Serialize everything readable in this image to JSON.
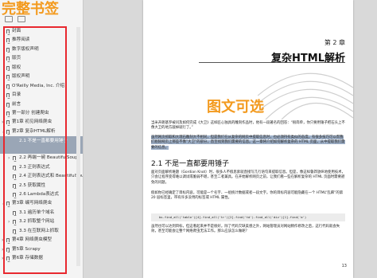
{
  "sidebar": {
    "banner": "完整书签",
    "items": [
      {
        "label": "封面",
        "chev": ""
      },
      {
        "label": "推荐阅读",
        "chev": ""
      },
      {
        "label": "数字版权声明",
        "chev": ""
      },
      {
        "label": "版页",
        "chev": ""
      },
      {
        "label": "版权",
        "chev": ""
      },
      {
        "label": "版权声明",
        "chev": ""
      },
      {
        "label": "O'Reilly Media, Inc. 介绍",
        "chev": ""
      },
      {
        "label": "目录",
        "chev": ""
      },
      {
        "label": "前言",
        "chev": ""
      },
      {
        "label": "第一部分 创建爬虫",
        "chev": ""
      },
      {
        "label": "第1章 初见网络爬虫",
        "chev": "›"
      },
      {
        "label": "第2章 复杂HTML解析",
        "chev": "⌄"
      },
      {
        "label": "2.1 不是一直都要用锤子",
        "chev": "",
        "selected": true
      },
      {
        "label": "2.2 再端一碗 BeautifulSoup",
        "chev": "›"
      },
      {
        "label": "2.3 正则表达式",
        "chev": ""
      },
      {
        "label": "2.4 正则表达式和 BeautifulSoup",
        "chev": ""
      },
      {
        "label": "2.5 获取属性",
        "chev": ""
      },
      {
        "label": "2.6 Lambda表达式",
        "chev": ""
      },
      {
        "label": "第3章 编写网络爬虫",
        "chev": "⌄"
      },
      {
        "label": "3.1 遍历单个域名",
        "chev": ""
      },
      {
        "label": "3.2 抓取整个网站",
        "chev": "›"
      },
      {
        "label": "3.3 在互联网上抓取",
        "chev": ""
      },
      {
        "label": "第4章 网络爬虫模型",
        "chev": "›"
      },
      {
        "label": "第5章 Scrapy",
        "chev": "›"
      },
      {
        "label": "第6章 存储数据",
        "chev": "›"
      }
    ]
  },
  "page": {
    "chapter_label": "第 2 章",
    "chapter_title": "复杂HTML解析",
    "overlay": "图文可选",
    "para1": "当米开朗基罗被问及如何完成《大卫》这样匠心独具的雕刻作品时，他有一段著名的回答：“很简单，你只要用锤子把石头上不像大卫的地方敲掉就行了。”",
    "para2_hl": "虽然网页抓取和大理石雕刻大不相同，但是我们在从复杂的网页中提取信息时，也必须持有类似的态度。有很多技巧可以帮我们剔除网页上那些不像“大卫”的部分，直至找到我们需要的信息。这一章将介绍如何解析复杂的 HTML 页面，从中提取我们需要的信息。",
    "section": "2.1 不是一直都要用锤子",
    "para3": "面对页面解析难题（Gordian Knot）时，很多人不假思索就直接写几行语句来提取信息。但是，像这样鲁莽放纵地使用技术，只会让程序变得难以调试或脆弱不堪，甚至二者兼具。在开始解析网页之前，让我们看一些在解析复杂的 HTML 页面时需要避免的问题。",
    "para4": "假如你已经确定了目标内容，可能是一个名字、一组统计数据或者一段文字。你的目标内容可能隐藏在一个 HTML“乱麻”的第 20 层标签里，带有许多没用的标签或 HTML 属性。",
    "code": "bs.find_all('table')[4].find_all('tr')[2].find('td').find_all('div')[1].find('a')",
    "para5": "虽然也可以达到目标，但这看起来并不是很好。除了代码欠缺美感之外，网站管理员对网站稍作修改之后，这行代码就会失效，甚至可能会让整个网络爬虫无法工作。那么应该怎么做呢？",
    "page_number": "13"
  }
}
